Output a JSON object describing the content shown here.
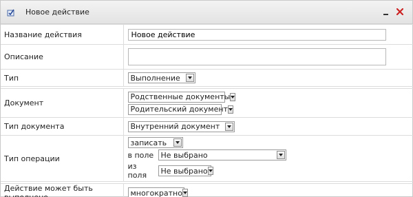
{
  "dialog": {
    "title": "Новое действие",
    "app_icon": "checklist-icon",
    "minimize_icon": "minimize-icon",
    "close_icon": "close-icon",
    "close_color": "#cc2222"
  },
  "form": {
    "name": {
      "label": "Название действия",
      "value": "Новое действие"
    },
    "description": {
      "label": "Описание",
      "value": ""
    },
    "type": {
      "label": "Тип",
      "selected": "Выполнение"
    },
    "document": {
      "label": "Документ",
      "select1": "Родственные документы",
      "select2": "Родительский документ"
    },
    "doc_type": {
      "label": "Тип документа",
      "selected": "Внутренний документ"
    },
    "operation": {
      "label": "Тип операции",
      "op_selected": "записать",
      "to_field_label": "в поле",
      "to_field_selected": "Не выбрано",
      "from_field_label": "из поля",
      "from_field_selected": "Не выбрано"
    },
    "execution": {
      "label": "Действие может быть выполнено",
      "selected": "многократно"
    }
  }
}
